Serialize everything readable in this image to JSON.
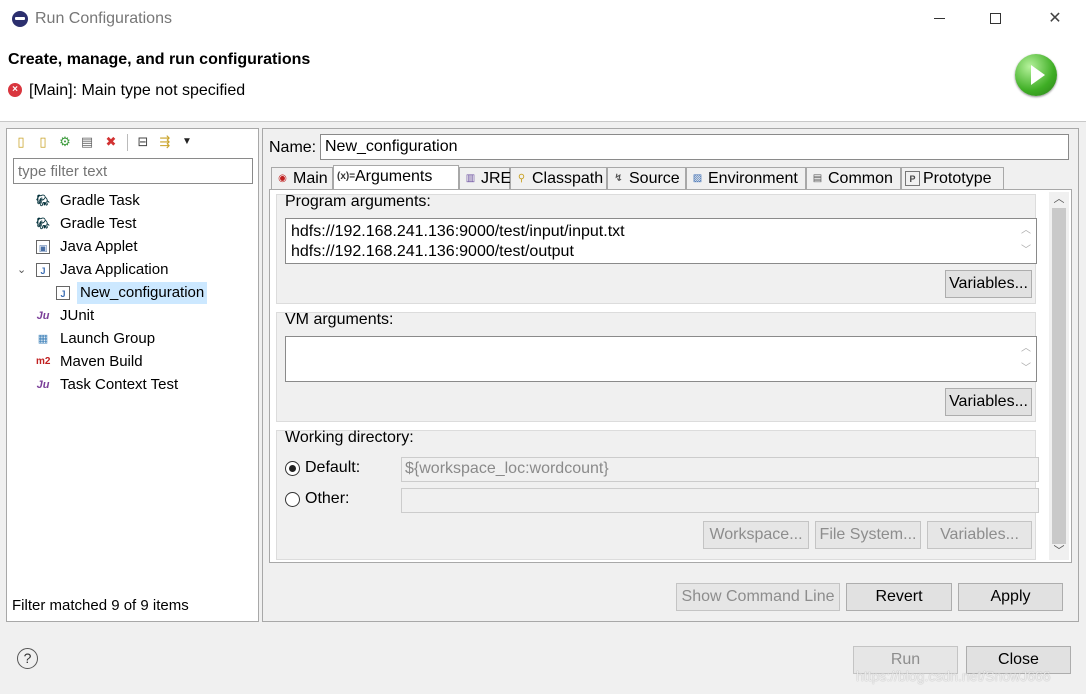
{
  "window": {
    "title": "Run Configurations",
    "minimize_label": "",
    "maximize_label": "",
    "close_label": "✕"
  },
  "header": {
    "title": "Create, manage, and run configurations",
    "message": "[Main]: Main type not specified",
    "error_icon": "error-icon",
    "run_icon": "run-icon"
  },
  "left_panel": {
    "toolbar_icons": [
      "new-config-icon",
      "new-prototype-icon",
      "export-icon",
      "duplicate-icon",
      "delete-icon",
      "collapse-all-icon",
      "filter-icon",
      "view-menu-icon"
    ],
    "filter_placeholder": "type filter text",
    "tree": [
      {
        "label": "Gradle Task",
        "icon": "gradle-icon"
      },
      {
        "label": "Gradle Test",
        "icon": "gradle-icon"
      },
      {
        "label": "Java Applet",
        "icon": "applet-icon"
      },
      {
        "label": "Java Application",
        "icon": "java-app-icon",
        "expanded": true
      },
      {
        "label": "New_configuration",
        "icon": "java-config-icon",
        "selected": true
      },
      {
        "label": "JUnit",
        "icon": "junit-icon"
      },
      {
        "label": "Launch Group",
        "icon": "launch-group-icon"
      },
      {
        "label": "Maven Build",
        "icon": "maven-icon"
      },
      {
        "label": "Task Context Test",
        "icon": "task-context-icon"
      }
    ],
    "status": "Filter matched 9 of 9 items"
  },
  "right_panel": {
    "name_label": "Name:",
    "name_value": "New_configuration",
    "tabs": [
      {
        "label": "Main",
        "icon": "main-icon"
      },
      {
        "label": "Arguments",
        "icon": "arguments-icon",
        "active": true
      },
      {
        "label": "JRE",
        "icon": "jre-icon"
      },
      {
        "label": "Classpath",
        "icon": "classpath-icon"
      },
      {
        "label": "Source",
        "icon": "source-icon"
      },
      {
        "label": "Environment",
        "icon": "environment-icon"
      },
      {
        "label": "Common",
        "icon": "common-icon"
      },
      {
        "label": "Prototype",
        "icon": "prototype-icon"
      }
    ],
    "program_args": {
      "label": "Program arguments:",
      "line1": "hdfs://192.168.241.136:9000/test/input/input.txt",
      "line2": "hdfs://192.168.241.136:9000/test/output",
      "variables_button": "Variables..."
    },
    "vm_args": {
      "label": "VM arguments:",
      "value": "",
      "variables_button": "Variables..."
    },
    "working_dir": {
      "label": "Working directory:",
      "default_label": "Default:",
      "default_value": "${workspace_loc:wordcount}",
      "other_label": "Other:",
      "other_value": "",
      "workspace_button": "Workspace...",
      "filesystem_button": "File System...",
      "variables_button": "Variables..."
    },
    "show_cmd_button": "Show Command Line",
    "revert_button": "Revert",
    "apply_button": "Apply"
  },
  "footer": {
    "help_label": "?",
    "run_button": "Run",
    "close_button": "Close",
    "watermark": "https://blog.csdn.net/SnowJ666"
  },
  "colors": {
    "selection": "#cce8ff",
    "error": "#d9363e",
    "run_green": "#3fae25"
  }
}
